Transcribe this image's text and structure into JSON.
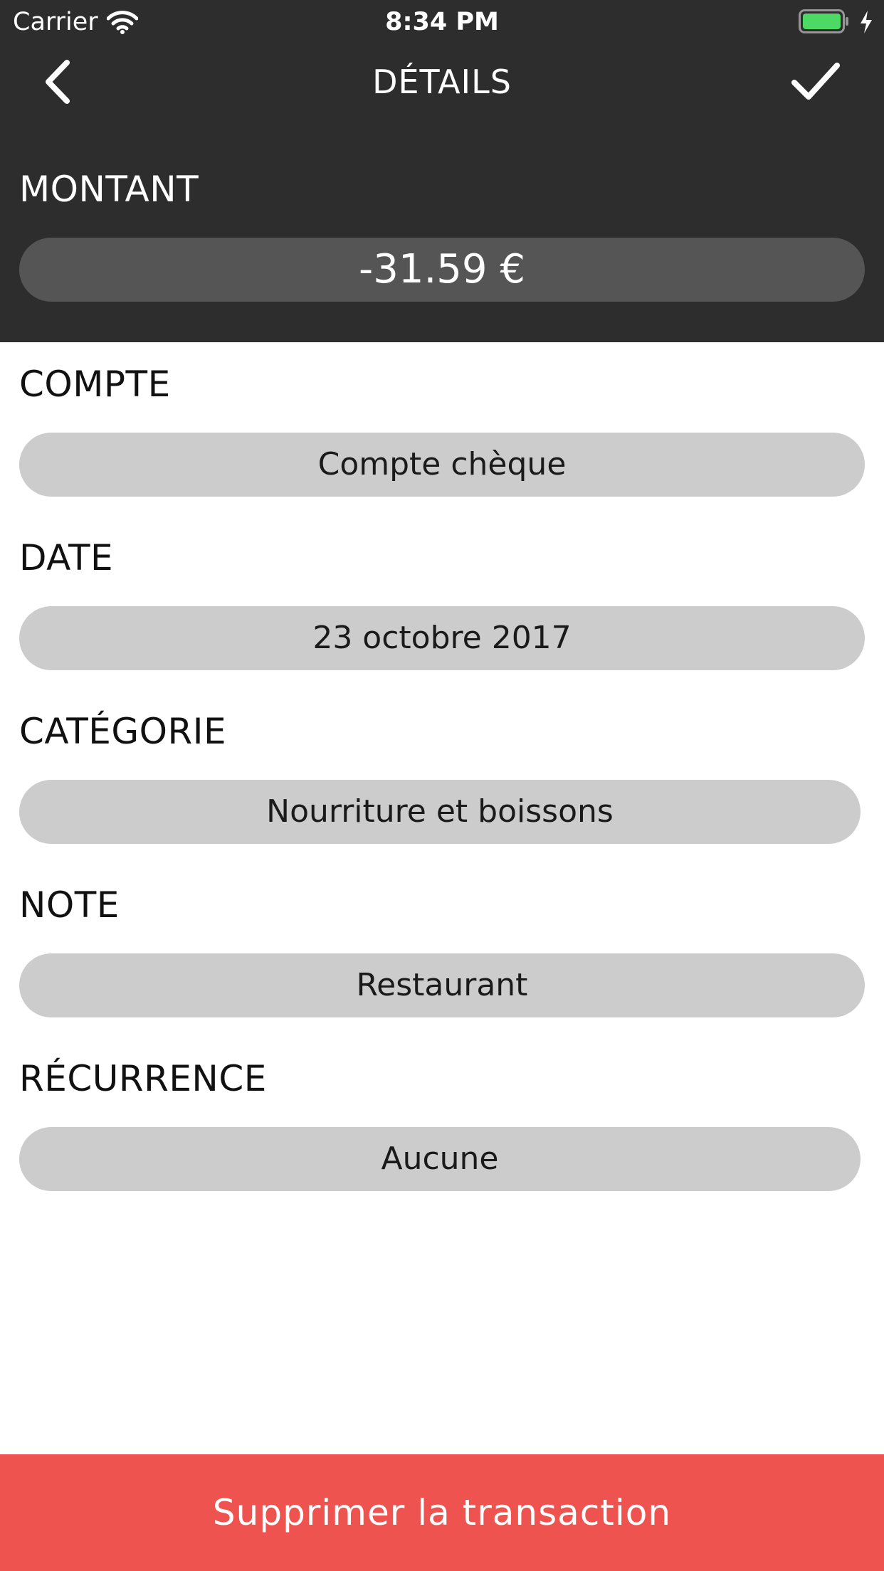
{
  "status_bar": {
    "carrier": "Carrier",
    "time": "8:34 PM",
    "battery_color": "#4cd964"
  },
  "nav": {
    "back_icon": "chevron-left-icon",
    "title": "DÉTAILS",
    "confirm_icon": "checkmark-icon"
  },
  "colors": {
    "header_background": "#2d2d2d",
    "pill_background": "#cccccc",
    "amount_pill_background": "#555555",
    "delete_button_background": "#ef5350"
  },
  "fields": {
    "amount": {
      "label": "MONTANT",
      "value": "-31.59 €"
    },
    "account": {
      "label": "COMPTE",
      "value": "Compte chèque"
    },
    "date": {
      "label": "DATE",
      "value": "23 octobre 2017"
    },
    "category": {
      "label": "CATÉGORIE",
      "value": "Nourriture et boissons"
    },
    "note": {
      "label": "NOTE",
      "value": "Restaurant"
    },
    "recurrence": {
      "label": "RÉCURRENCE",
      "value": "Aucune"
    }
  },
  "delete_button": {
    "label": "Supprimer la transaction"
  }
}
